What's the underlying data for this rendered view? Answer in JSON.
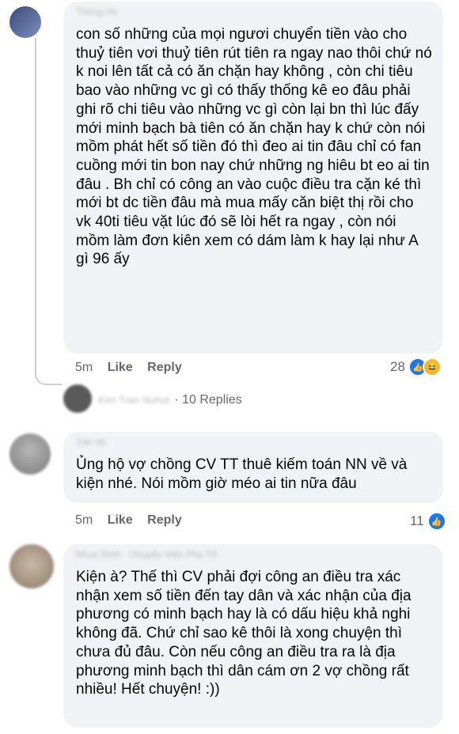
{
  "comments": [
    {
      "author": "Thông Ho",
      "text": "con số những của mọi ngươi chuyển tiền vào cho thuỷ tiên vơi thuỷ tiên rút tiên ra ngay nao thôi chứ nó k noi lên tất cả có ăn chặn hay không , còn chi tiêu bao vào những vc gì có thấy thống kê eo đâu phải ghi rõ chi tiêu vào những vc gì còn lại bn thì lúc đấy mới minh bạch bà tiên có ăn chặn hay k chứ còn nói mồm phát hết số tiền đó thì đeo ai tin đâu chỉ có fan cuồng mới tin bon nay chứ những ng hiêu bt eo ai tin đâu . Bh chỉ có công an vào cuộc điều tra cặn ké thì mới bt dc tiền đâu mà mua mấy căn biệt thị rồi cho vk 40ti tiêu vặt lúc đó sẽ lòi hết ra ngay , còn nói mồm làm đơn kiên xem có dám làm k hay lại như A gì 96 ấy",
      "time": "5m",
      "like_label": "Like",
      "reply_label": "Reply",
      "reaction_count": "28"
    },
    {
      "author": "Tân Vo",
      "text": "Ủng hộ vợ chồng CV TT thuê kiếm toán NN về và kiện nhé. Nói mồm giờ méo ai tin nữa đâu",
      "time": "5m",
      "like_label": "Like",
      "reply_label": "Reply",
      "reaction_count": "11"
    },
    {
      "author": "Nhue Đinh · Chuyên Viên Pha Tổ",
      "text": "Kiện à? Thế thì CV phải đợi công an điều tra xác nhận xem số tiền đến tay dân và xác nhận của địa phương có minh bạch hay là có dấu hiệu khả nghi không đã. Chứ chỉ sao kê thôi là xong chuyện thì chưa đủ đâu. Còn nếu công an điều tra ra là địa phương minh bạch thì dân cám ơn 2 vợ chồng rất nhiều! Hết chuyện! :))"
    }
  ],
  "replies_preview": {
    "author": "Kim Tran Nuhut",
    "label": "· 10 Replies"
  },
  "colors": {
    "accent": "#1877f2",
    "bubble": "#f0f2f5",
    "meta": "#65676b"
  },
  "icons": [
    "like-icon",
    "haha-icon"
  ]
}
